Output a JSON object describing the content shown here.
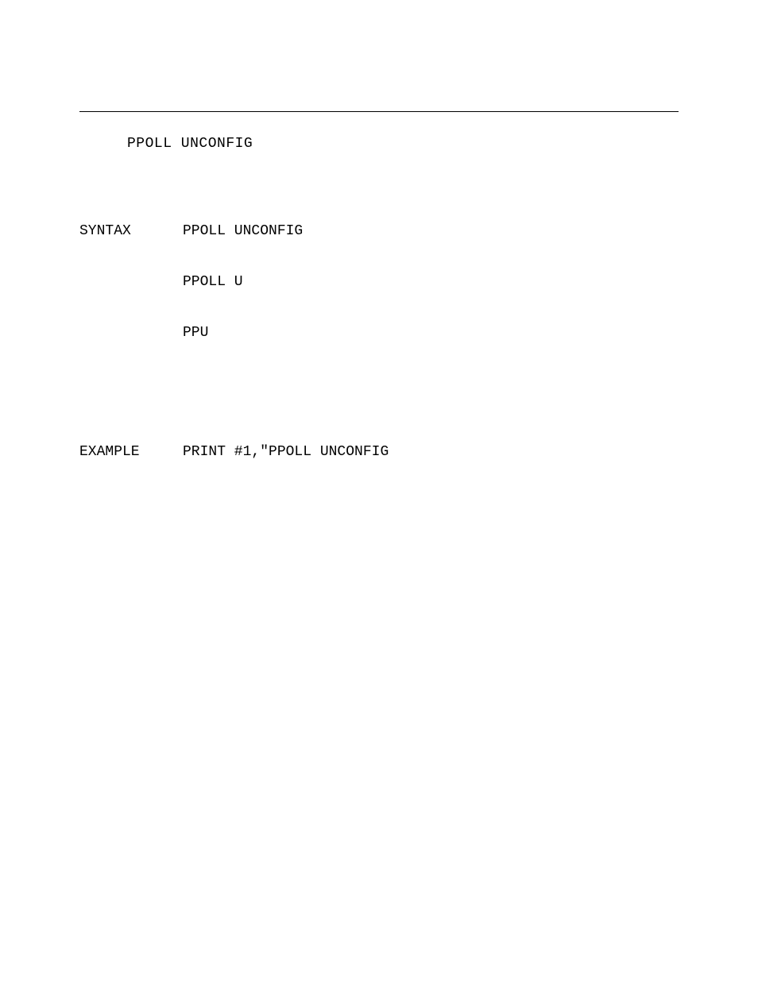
{
  "title": "PPOLL UNCONFIG",
  "syntax": {
    "label": "SYNTAX",
    "lines": [
      "PPOLL UNCONFIG",
      "PPOLL U",
      "PPU"
    ]
  },
  "example": {
    "label": "EXAMPLE",
    "text": "PRINT #1,\"PPOLL UNCONFIG"
  }
}
